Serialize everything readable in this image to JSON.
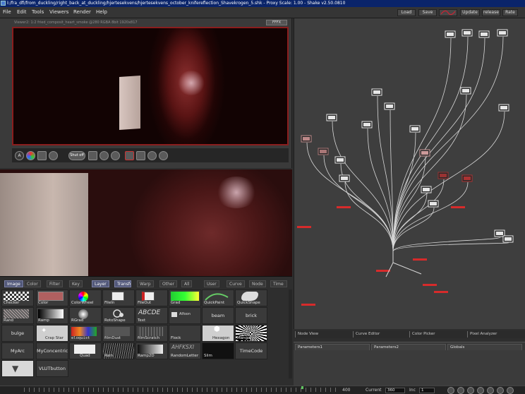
{
  "window": {
    "title": "I:/fra_dfi/from_duckling/right_back_at_duckling/hjertesekvens/hjertesekvens_october_knifereflection_Shavekrogen_5.shk - Proxy Scale: 1.00 - Shake v2.50.0810"
  },
  "menu": [
    "File",
    "Edit",
    "Tools",
    "Viewers",
    "Render",
    "Help"
  ],
  "toolbar": {
    "load": "Load",
    "save": "Save",
    "update": "Update",
    "release": "release",
    "rate": "Rate"
  },
  "viewer": {
    "label": "Viewer2: 1:2 fried_composit_heart_smoke @280 RGBA 8bit 1920x817",
    "flag": "FFFX",
    "letter": "A",
    "shutoff": "Shut off"
  },
  "tool_tabs": [
    "Image",
    "Color",
    "Filter",
    "Key",
    "Layer",
    "Transform",
    "Warp",
    "Other",
    "All",
    "User",
    "Curve",
    "Node",
    "Time"
  ],
  "tools": [
    "Checker",
    "Color",
    "ColorWheel",
    "FileIn",
    "FileOut",
    "Grad",
    "QuickPaint",
    "QuickShape",
    "Rand",
    "Ramp",
    "RGrad",
    "RotoShape",
    "Text",
    "Alfoon",
    "beam",
    "brick",
    "bulge",
    "Crap Star",
    "eloquist",
    "filmDust",
    "filmScratch",
    "Flock",
    "Hexagon",
    "Manga",
    "MyArc",
    "MyConcentric",
    "Quad",
    "Rain",
    "Ramp2D",
    "RandomLetter",
    "Slim",
    "TimeCode",
    "VLUTbutton"
  ],
  "thumb_text": {
    "text": "ABCDE",
    "randomletter": "AHFKSXI"
  },
  "view_tabs": [
    "Node View",
    "Curve Editor",
    "Color Picker",
    "Pixel Analyzer"
  ],
  "param_tabs": [
    "Parameters1",
    "Parameters2",
    "Globals"
  ],
  "timeline": {
    "frame_end": "400",
    "current_label": "Current",
    "current_value": "360",
    "inc_label": "Inc",
    "inc_value": "1"
  },
  "colors": {
    "selection": "#c0c0c0",
    "active_tab": "#52587a",
    "viewer_border": "#8a1d1d",
    "node_line": "#d9d9d9"
  }
}
